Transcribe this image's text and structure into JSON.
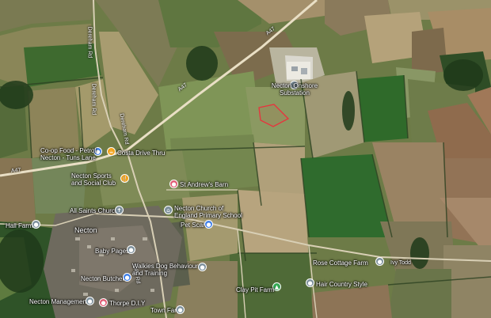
{
  "map": {
    "roads": {
      "a47_label": "A47",
      "dereham_rd_1": "Dereham Rd",
      "dereham_rd_2": "Dereham Rd",
      "hale_rd": "Hale Rd"
    },
    "places": {
      "substation": "Necton Onshore\nSubstation",
      "coop": "Co-op Food - Petrol\nNecton - Tuns Lane",
      "costa": "Costa Drive Thru",
      "sports_club": "Necton Sports\nand Social Club",
      "st_andrews_barn": "St Andrew's Barn",
      "all_saints": "All Saints Church",
      "primary_school": "Necton Church of\nEngland Primary School",
      "hall_farm": "Hall Farm",
      "necton": "Necton",
      "pet_scan": "Pet Scan",
      "baby_pages": "Baby Pages",
      "walkies": "Walkies Dog Behaviour\nand Training",
      "butchers": "Necton Butchers",
      "management": "Necton Management",
      "thorpe": "Thorpe D.I.Y",
      "town_farm": "Town Farm",
      "clay_pit": "Clay Pit Farm",
      "hair_country": "Hair Country Style",
      "rose_cottage": "Rose Cottage Farm",
      "ivy_todd": "Ivy Todd"
    }
  },
  "colors": {
    "restaurant": "#f2a21b",
    "shopping": "#3f7fe8",
    "place": "#4a77a5",
    "attraction": "#e15b73",
    "farm_icon": "#7c8f9b",
    "park": "#34a853",
    "selection": "#e8333d"
  }
}
